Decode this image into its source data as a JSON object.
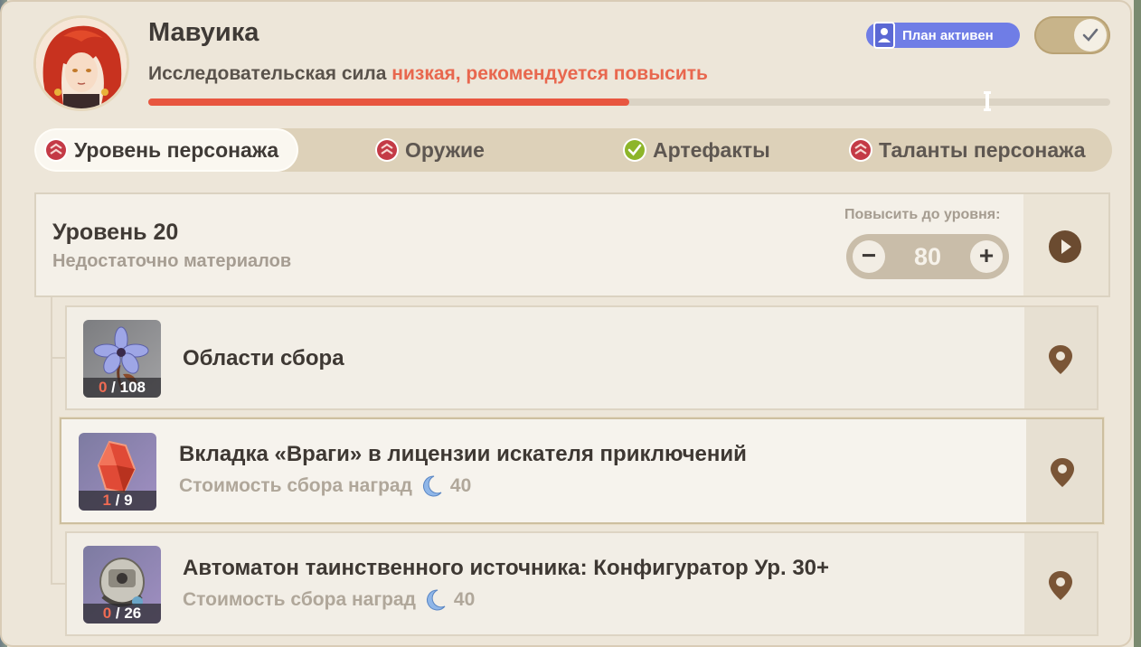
{
  "header": {
    "character_name": "Мавуика",
    "power_prefix": "Исследовательская сила ",
    "power_warning": "низкая, рекомендуется повысить",
    "progress_percent": 50,
    "plan_label": "План активен",
    "plan_toggle_on": true
  },
  "tabs": [
    {
      "label": "Уровень персонажа",
      "status": "pending",
      "active": true
    },
    {
      "label": "Оружие",
      "status": "pending",
      "active": false
    },
    {
      "label": "Артефакты",
      "status": "done",
      "active": false
    },
    {
      "label": "Таланты персонажа",
      "status": "pending",
      "active": false
    }
  ],
  "level": {
    "title": "Уровень 20",
    "subtitle": "Недостаточно материалов",
    "raise_label": "Повысить до уровня:",
    "target_value": "80",
    "minus": "−",
    "plus": "+"
  },
  "materials": [
    {
      "title": "Области сбора",
      "current": "0",
      "total": " / 108",
      "subtitle": "",
      "cost": "",
      "icon": "flower-icon"
    },
    {
      "title": "Вкладка «Враги» в лицензии искателя приключений",
      "current": "1",
      "total": " / 9",
      "subtitle": "Стоимость сбора наград",
      "cost": "40",
      "icon": "crystal-icon"
    },
    {
      "title": "Автоматон таинственного источника: Конфигуратор Ур. 30+",
      "current": "0",
      "total": " / 26",
      "subtitle": "Стоимость сбора наград",
      "cost": "40",
      "icon": "automaton-icon"
    }
  ],
  "colors": {
    "accent_red": "#e8563f",
    "plan_blue": "#6f7de6",
    "pending_red": "#c43a46",
    "done_green": "#8db52a"
  }
}
